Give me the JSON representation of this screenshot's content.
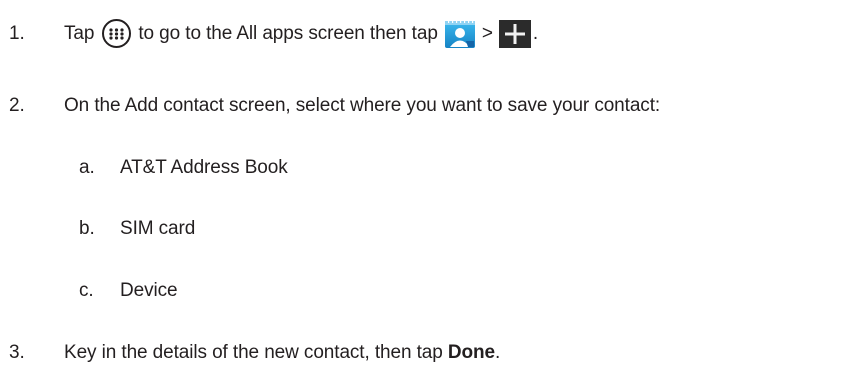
{
  "steps": [
    {
      "number": "1.",
      "part1": "Tap",
      "part2": "to go to the All apps screen then tap",
      "separator": ">",
      "end": ".",
      "icons": [
        "apps-icon",
        "contacts-icon",
        "add-icon"
      ]
    },
    {
      "number": "2.",
      "text": "On the Add contact screen, select where you want to save your contact:",
      "options": [
        {
          "letter": "a.",
          "label": "AT&T Address Book"
        },
        {
          "letter": "b.",
          "label": "SIM card"
        },
        {
          "letter": "c.",
          "label": "Device"
        }
      ]
    },
    {
      "number": "3.",
      "part1": "Key in the details of the new contact, then tap",
      "bold": "Done",
      "end": "."
    }
  ],
  "colors": {
    "text": "#231f20",
    "contacts_icon_bg": "#1e9bd7",
    "add_icon_bg": "#2b2b2b"
  }
}
